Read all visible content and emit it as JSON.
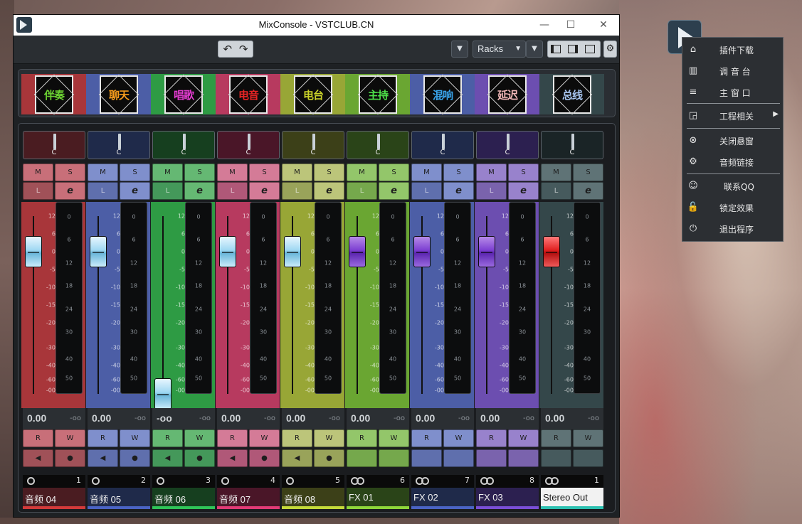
{
  "window": {
    "title": "MixConsole - VSTCLUB.CN",
    "minimize_glyph": "—",
    "maximize_glyph": "☐",
    "close_glyph": "✕"
  },
  "toolbar": {
    "undo_icon": "↶",
    "redo_icon": "↷",
    "dropdown_glyph": "▼",
    "racks_label": "Racks",
    "racks_arrow": "▼"
  },
  "colors": {
    "red": "#a8363a",
    "blue": "#4c5ea6",
    "green": "#2e9b44",
    "pink": "#b73a5f",
    "olive": "#98a636",
    "lime": "#6aa632",
    "purple": "#6c4eb0",
    "slate": "#34474a",
    "accent_blue": "#56c1e8"
  },
  "selector": [
    {
      "label": "伴奏",
      "text_color": "#6bd132",
      "bg": "#a8363a"
    },
    {
      "label": "聊天",
      "text_color": "#f39a1c",
      "bg": "#4c5ea6"
    },
    {
      "label": "唱歌",
      "text_color": "#e23ccf",
      "bg": "#2e9b44"
    },
    {
      "label": "电音",
      "text_color": "#e82525",
      "bg": "#b73a5f"
    },
    {
      "label": "电台",
      "text_color": "#c9d22a",
      "bg": "#98a636"
    },
    {
      "label": "主持",
      "text_color": "#4ee04a",
      "bg": "#6aa632"
    },
    {
      "label": "混响",
      "text_color": "#3aa6ee",
      "bg": "#4c5ea6"
    },
    {
      "label": "延迟",
      "text_color": "#f2b8b8",
      "bg": "#6c4eb0"
    },
    {
      "label": "总线",
      "text_color": "#a9c7f2",
      "bg": "#34474a"
    }
  ],
  "channels": [
    {
      "name": "音频 04",
      "number": "1",
      "level": "0.00",
      "peak": "-oo",
      "pan": "C",
      "color": "#a8363a",
      "pan_bg": "#4a1c21",
      "btn": "#c86f79",
      "btn_dark": "#a05158",
      "bar": "#d23a3a",
      "cap": "light",
      "fader_db": 0,
      "stereo": false,
      "has_le": true,
      "has_spk": true
    },
    {
      "name": "音频 05",
      "number": "2",
      "level": "0.00",
      "peak": "-oo",
      "pan": "C",
      "color": "#4c5ea6",
      "pan_bg": "#1f2a4a",
      "btn": "#7f8fcc",
      "btn_dark": "#5f6fad",
      "bar": "#4a63c4",
      "cap": "light",
      "fader_db": 0,
      "stereo": false,
      "has_le": true,
      "has_spk": true
    },
    {
      "name": "音频 06",
      "number": "3",
      "level": "-oo",
      "peak": "-oo",
      "pan": "C",
      "color": "#2e9b44",
      "pan_bg": "#163f1f",
      "btn": "#65b873",
      "btn_dark": "#44985a",
      "bar": "#2fc458",
      "cap": "light",
      "fader_db": -1000,
      "stereo": false,
      "has_le": true,
      "has_spk": true
    },
    {
      "name": "音频 07",
      "number": "4",
      "level": "0.00",
      "peak": "-oo",
      "pan": "C",
      "color": "#b73a5f",
      "pan_bg": "#4a1628",
      "btn": "#d47b97",
      "btn_dark": "#b05878",
      "bar": "#e03b76",
      "cap": "light",
      "fader_db": 0,
      "stereo": false,
      "has_le": true,
      "has_spk": true
    },
    {
      "name": "音频 08",
      "number": "5",
      "level": "0.00",
      "peak": "-oo",
      "pan": "C",
      "color": "#98a636",
      "pan_bg": "#3c4018",
      "btn": "#bcc57a",
      "btn_dark": "#99a35a",
      "bar": "#c4d93a",
      "cap": "light",
      "fader_db": 0,
      "stereo": false,
      "has_le": true,
      "has_spk": true
    },
    {
      "name": "FX 01",
      "number": "6",
      "level": "0.00",
      "peak": "-oo",
      "pan": "C",
      "color": "#6aa632",
      "pan_bg": "#2a4418",
      "btn": "#93c66a",
      "btn_dark": "#75a84c",
      "bar": "#8ed63a",
      "cap": "purple",
      "fader_db": 0,
      "stereo": true,
      "has_le": true,
      "has_spk": false
    },
    {
      "name": "FX 02",
      "number": "7",
      "level": "0.00",
      "peak": "-oo",
      "pan": "C",
      "color": "#4c5ea6",
      "pan_bg": "#1f2a4a",
      "btn": "#7f8fcc",
      "btn_dark": "#5f6fad",
      "bar": "#4a63c4",
      "cap": "purple",
      "fader_db": 0,
      "stereo": true,
      "has_le": true,
      "has_spk": false
    },
    {
      "name": "FX 03",
      "number": "8",
      "level": "0.00",
      "peak": "-oo",
      "pan": "C",
      "color": "#6c4eb0",
      "pan_bg": "#2c2050",
      "btn": "#9882cc",
      "btn_dark": "#7a63ad",
      "bar": "#7a4ed6",
      "cap": "purple",
      "fader_db": 0,
      "stereo": true,
      "has_le": true,
      "has_spk": false
    },
    {
      "name": "Stereo Out",
      "number": "1",
      "level": "0.00",
      "peak": "-oo",
      "pan": "C",
      "color": "#34474a",
      "pan_bg": "#1a2426",
      "btn": "#5f7376",
      "btn_dark": "#465a5d",
      "bar": "#2cc0b0",
      "cap": "red",
      "fader_db": 0,
      "stereo": true,
      "has_le": true,
      "has_spk": false,
      "name_light": true
    }
  ],
  "button_labels": {
    "mute": "M",
    "solo": "S",
    "listen": "L",
    "edit": "e",
    "read": "R",
    "write": "W",
    "speaker": "◀",
    "record": "●"
  },
  "fader_scale": [
    "12",
    "6",
    "0",
    "-5",
    "-10",
    "-15",
    "-20",
    "-30",
    "-40",
    "-60",
    "-00"
  ],
  "meter_scale": [
    "0",
    "6",
    "12",
    "18",
    "24",
    "30",
    "40",
    "50"
  ],
  "context_menu": {
    "items": [
      {
        "icon": "⌂",
        "icon_name": "home-icon",
        "label": "插件下载"
      },
      {
        "icon": "▥",
        "icon_name": "mixer-icon",
        "label": "调 音 台"
      },
      {
        "icon": "≡",
        "icon_name": "menu-icon",
        "label": "主 窗 口"
      },
      {
        "icon": "◲",
        "icon_name": "project-icon",
        "label": "工程相关",
        "submenu": "▶"
      },
      {
        "icon": "⊗",
        "icon_name": "close-circle-icon",
        "label": "关闭悬窗"
      },
      {
        "icon": "⚙",
        "icon_name": "gear-icon",
        "label": "音频链接"
      },
      {
        "icon": "☺",
        "icon_name": "qq-icon",
        "label": "联系QQ"
      },
      {
        "icon": "🔓",
        "icon_name": "unlock-icon",
        "label": "锁定效果"
      },
      {
        "icon": "⏻",
        "icon_name": "power-icon",
        "label": "退出程序"
      }
    ]
  }
}
